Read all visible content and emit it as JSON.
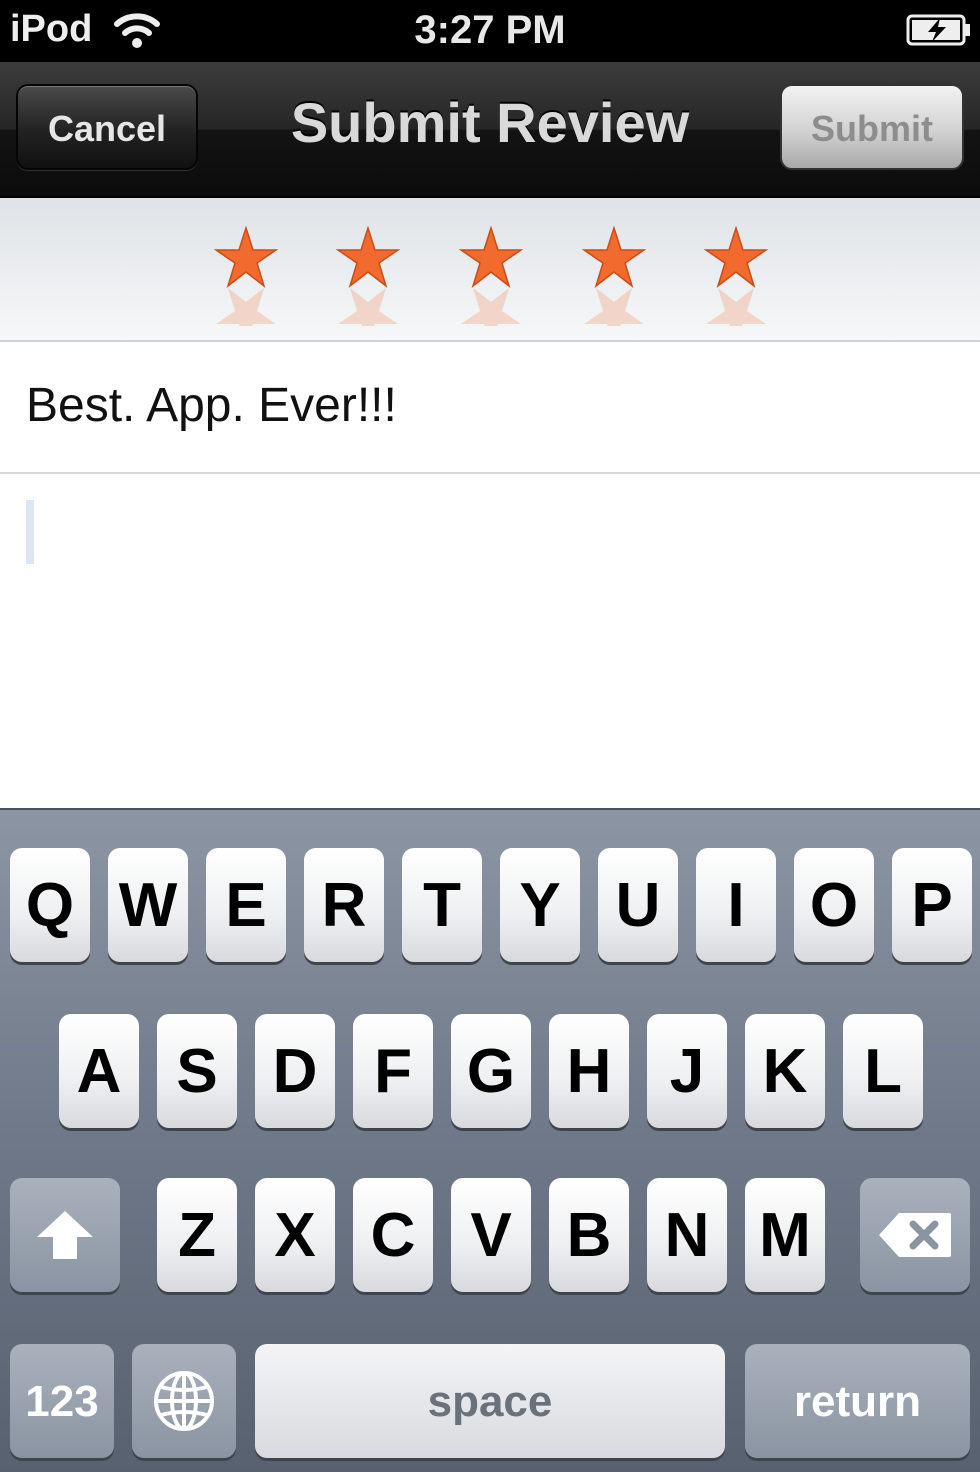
{
  "status_bar": {
    "carrier": "iPod",
    "time": "3:27 PM",
    "wifi_icon": "wifi-icon",
    "battery_icon": "battery-charging-icon"
  },
  "nav_bar": {
    "cancel_label": "Cancel",
    "title": "Submit Review",
    "submit_label": "Submit",
    "submit_enabled": false
  },
  "rating": {
    "value": 5,
    "max": 5,
    "star_color": "#f26a2e"
  },
  "review": {
    "title_value": "Best. App. Ever!!!",
    "body_value": ""
  },
  "keyboard": {
    "row1": [
      "Q",
      "W",
      "E",
      "R",
      "T",
      "Y",
      "U",
      "I",
      "O",
      "P"
    ],
    "row2": [
      "A",
      "S",
      "D",
      "F",
      "G",
      "H",
      "J",
      "K",
      "L"
    ],
    "row3": [
      "Z",
      "X",
      "C",
      "V",
      "B",
      "N",
      "M"
    ],
    "shift_icon": "shift-arrow-icon",
    "delete_icon": "backspace-icon",
    "numbers_label": "123",
    "globe_icon": "globe-icon",
    "space_label": "space",
    "return_label": "return"
  }
}
